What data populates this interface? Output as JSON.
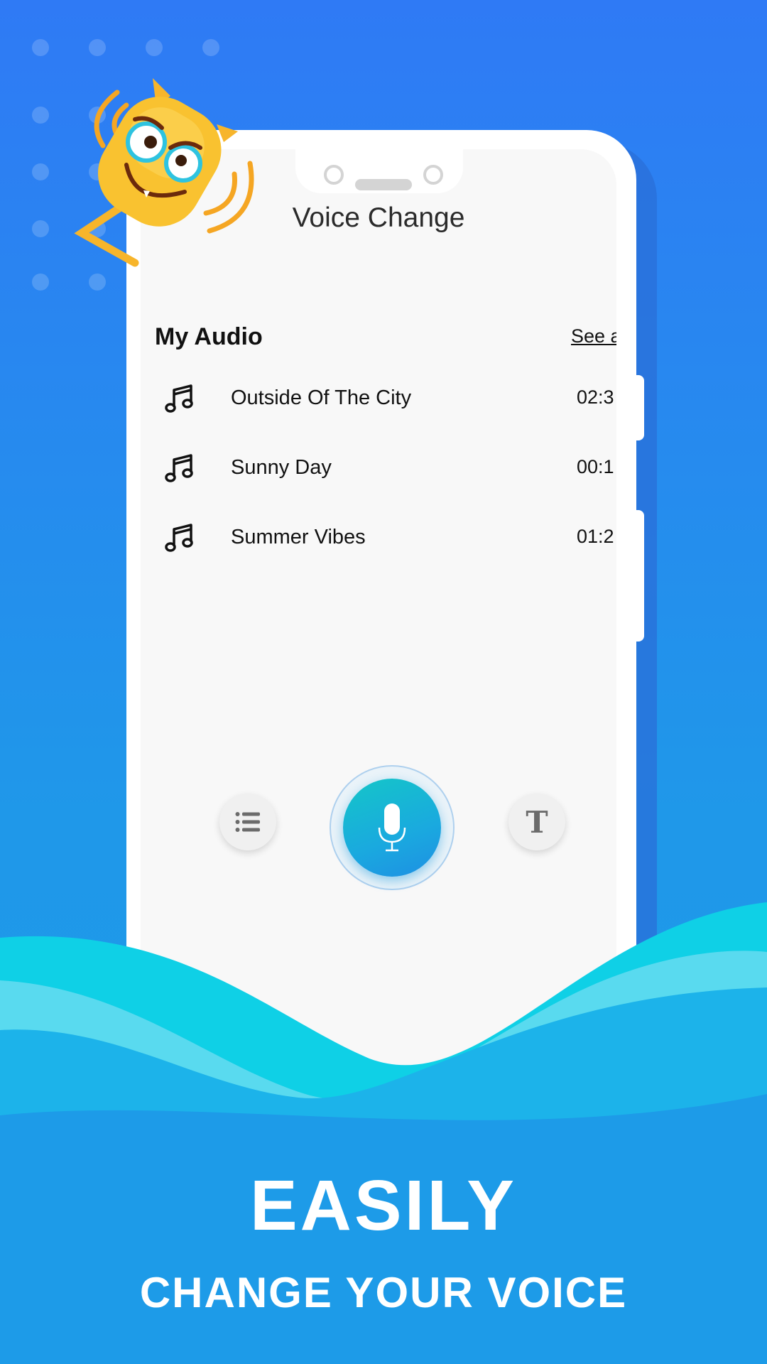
{
  "app": {
    "title": "Voice Change"
  },
  "my_audio": {
    "title": "My Audio",
    "see_all_label": "See a",
    "items": [
      {
        "name": "Outside Of The City",
        "duration": "02:3",
        "icon": "music-note-icon"
      },
      {
        "name": "Sunny Day",
        "duration": "00:1",
        "icon": "music-note-icon"
      },
      {
        "name": "Summer Vibes",
        "duration": "01:2",
        "icon": "music-note-icon"
      }
    ]
  },
  "controls": {
    "left_icon": "list-icon",
    "center_icon": "microphone-icon",
    "right_icon": "text-icon",
    "right_glyph": "T"
  },
  "promo": {
    "headline": "EASILY",
    "subline": "CHANGE YOUR VOICE"
  },
  "colors": {
    "background_top": "#2f7af5",
    "background_bottom": "#1d9be8",
    "mic_gradient_start": "#14c6c8",
    "mic_gradient_end": "#1e8fe3",
    "wave_cyan": "#0fd0e6",
    "mascot_yellow": "#f7b52b"
  }
}
